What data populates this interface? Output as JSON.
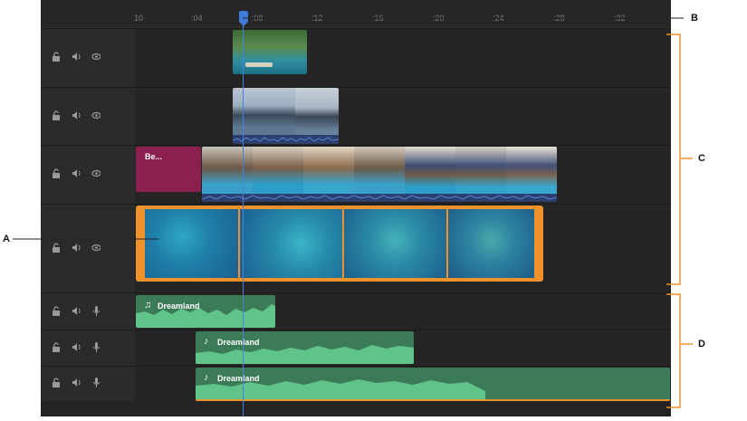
{
  "timeline": {
    "ruler_ticks": [
      "10",
      ":04",
      ":08",
      ":12",
      ":16",
      ":20",
      ":24",
      ":28",
      ":32"
    ],
    "title_clip_label": "Be...",
    "audio_clips": [
      {
        "label": "Dreamland",
        "icon": "voice-music-icon"
      },
      {
        "label": "Dreamland",
        "icon": "music-note-icon"
      },
      {
        "label": "Dreamland",
        "icon": "music-note-icon"
      }
    ]
  },
  "callouts": {
    "a": "A",
    "b": "B",
    "c": "C",
    "d": "D"
  },
  "colors": {
    "panel_bg": "#232323",
    "selection_orange": "#f0922b",
    "title_clip": "#8b1f4e",
    "audio_fill": "#5fc38a",
    "audio_bg": "#3c7b57",
    "playhead": "#3f7ad8",
    "waveform_blue": "#3f6fb8"
  }
}
